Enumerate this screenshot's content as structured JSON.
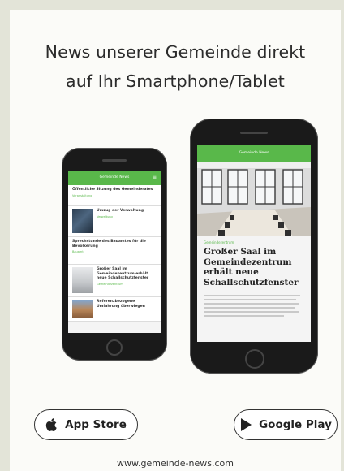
{
  "headline": {
    "line1": "News unserer Gemeinde direkt",
    "line2": "auf Ihr Smartphone/Tablet"
  },
  "small_phone": {
    "app_bar": "Gemeinde News",
    "items": [
      {
        "title": "Öffentliche Sitzung des Gemeinderates",
        "meta": "Veranstaltung"
      },
      {
        "title": "Umzug der Verwaltung",
        "meta": "Verwaltung"
      },
      {
        "title": "Sprechstunde des Bauamtes für die Bevölkerung",
        "meta": "Bauamt"
      },
      {
        "title": "Großer Saal im Gemeindezentrum erhält neue Schallschutzfenster",
        "meta": "Gemeindezentrum"
      },
      {
        "title": "Referenzbezogene Umfahrung überwiegen",
        "meta": ""
      }
    ]
  },
  "large_phone": {
    "app_bar": "Gemeinde News",
    "meta": "Gemeindezentrum",
    "title": "Großer Saal im Gemeindezentrum erhält neue Schallschutzfenster"
  },
  "stores": {
    "app_store": "App Store",
    "google_play": "Google Play"
  },
  "website": "www.gemeinde-news.com",
  "colors": {
    "accent": "#59b84a",
    "phone": "#1a1a1a"
  },
  "icons": {
    "apple": "apple-icon",
    "play": "play-icon"
  }
}
